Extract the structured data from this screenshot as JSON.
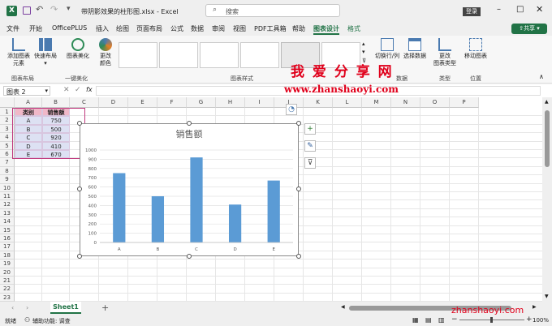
{
  "titlebar": {
    "file_name": "带阴影效果的柱形图.xlsx",
    "separator": " - ",
    "app_name": "Excel",
    "search_placeholder": "搜索",
    "login_label": "登录",
    "autosave_icon": "save-icon"
  },
  "ribbon_tabs": [
    "文件",
    "开始",
    "OfficePLUS",
    "插入",
    "绘图",
    "页面布局",
    "公式",
    "数据",
    "审阅",
    "视图",
    "PDF工具箱",
    "帮助",
    "图表设计",
    "格式"
  ],
  "active_tab": "图表设计",
  "share_label": "共享",
  "ribbon": {
    "add_element": "添加图表\n元素",
    "quick_layout": "快速布局",
    "chart_beautify": "图表美化",
    "change_color": "更改\n颜色",
    "switch_row_col": "切换行/列",
    "select_data": "选择数据",
    "change_type": "更改\n图表类型",
    "move_chart": "移动图表",
    "groups": {
      "layout": "图表布局",
      "one_click": "一键美化",
      "styles": "图表样式",
      "data": "数据",
      "type": "类型",
      "location": "位置"
    }
  },
  "formula_bar": {
    "name_box": "图表 2",
    "fx": "fx"
  },
  "columns": [
    "A",
    "B",
    "C",
    "D",
    "E",
    "F",
    "G",
    "H",
    "I",
    "J",
    "K",
    "L",
    "M",
    "N",
    "O",
    "P"
  ],
  "rows": [
    "1",
    "2",
    "3",
    "4",
    "5",
    "6",
    "7",
    "8",
    "9",
    "10",
    "11",
    "12",
    "13",
    "14",
    "15",
    "16",
    "17",
    "18",
    "19",
    "20",
    "21",
    "22",
    "23",
    "24"
  ],
  "table": {
    "headers": [
      "类别",
      "销售额"
    ],
    "rows": [
      [
        "A",
        "750"
      ],
      [
        "B",
        "500"
      ],
      [
        "C",
        "920"
      ],
      [
        "D",
        "410"
      ],
      [
        "E",
        "670"
      ]
    ]
  },
  "chart_data": {
    "type": "bar",
    "title": "销售额",
    "categories": [
      "A",
      "B",
      "C",
      "D",
      "E"
    ],
    "values": [
      750,
      500,
      920,
      410,
      670
    ],
    "ylim": [
      0,
      1000
    ],
    "yticks": [
      "0",
      "100",
      "200",
      "300",
      "400",
      "500",
      "600",
      "700",
      "800",
      "900",
      "1000"
    ],
    "bar_color": "#5b9bd5",
    "grid": true,
    "legend": "none"
  },
  "sheet": {
    "name": "Sheet1",
    "add": "+"
  },
  "status": {
    "mode": "就绪",
    "accessibility": "辅助功能: 调查",
    "zoom": "100%"
  },
  "watermark": {
    "line1": "我 爱 分 享 网",
    "line2": "www.zhanshaoyi.com",
    "line3": "zhanshaoyi.com"
  },
  "colors": {
    "accent": "#217346",
    "watermark_red": "#e0001b"
  }
}
